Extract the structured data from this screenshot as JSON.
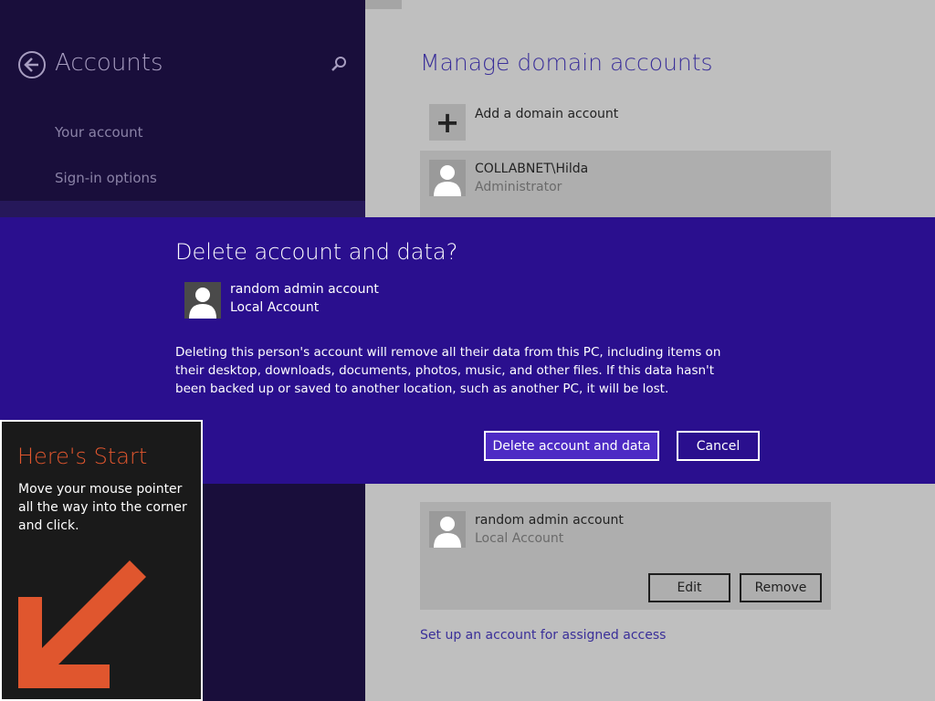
{
  "left_pane": {
    "title": "Accounts",
    "nav_items": [
      "Your account",
      "Sign-in options"
    ]
  },
  "content": {
    "title": "Manage domain accounts",
    "add_account_label": "Add a domain account",
    "accounts": [
      {
        "name": "COLLABNET\\Hilda",
        "type": "Administrator"
      },
      {
        "name": "random admin account",
        "type": "Local Account"
      }
    ],
    "edit_label": "Edit",
    "remove_label": "Remove",
    "assigned_access_link": "Set up an account for assigned access"
  },
  "dialog": {
    "title": "Delete account and data?",
    "account_name": "random admin account",
    "account_type": "Local Account",
    "message": "Deleting this person's account will remove all their data from this PC, including items on their desktop, downloads, documents, photos, music, and other files. If this data hasn't been backed up or saved to another location, such as another PC, it will be lost.",
    "delete_label": "Delete account and data",
    "cancel_label": "Cancel"
  },
  "tip": {
    "title": "Here's Start",
    "body": "Move your mouse pointer all the way into the corner and click."
  },
  "colors": {
    "left_pane_bg": "#190e3b",
    "dialog_bg": "#2a0f8e",
    "accent_text": "#3a2f99",
    "tip_accent": "#e0562e"
  },
  "icons": [
    "back-arrow-icon",
    "search-icon",
    "plus-icon",
    "user-avatar-icon",
    "corner-arrow-icon"
  ]
}
